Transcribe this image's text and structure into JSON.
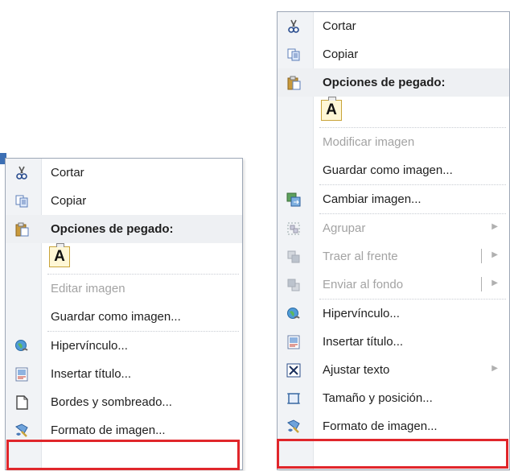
{
  "left_menu": {
    "items": [
      {
        "id": "cut",
        "label": "Cortar",
        "icon": "scissors-icon",
        "type": "item"
      },
      {
        "id": "copy",
        "label": "Copiar",
        "icon": "copy-icon",
        "type": "item"
      },
      {
        "id": "paste-header",
        "label": "Opciones de pegado:",
        "icon": "clipboard-icon",
        "type": "header"
      },
      {
        "id": "paste-text",
        "label": "A",
        "icon": "paste-keep-text-icon",
        "type": "paste"
      },
      {
        "id": "edit-image",
        "label": "Editar imagen",
        "type": "disabled"
      },
      {
        "id": "save-as-image",
        "label": "Guardar como imagen...",
        "type": "item"
      },
      {
        "id": "hyperlink",
        "label": "Hipervínculo...",
        "icon": "globe-link-icon",
        "type": "item"
      },
      {
        "id": "insert-caption",
        "label": "Insertar título...",
        "icon": "caption-icon",
        "type": "item"
      },
      {
        "id": "borders-shading",
        "label": "Bordes y sombreado...",
        "icon": "page-border-icon",
        "type": "item"
      },
      {
        "id": "format-picture",
        "label": "Formato de imagen...",
        "icon": "format-picture-icon",
        "type": "item",
        "highlighted": true
      }
    ]
  },
  "right_menu": {
    "items": [
      {
        "id": "cut",
        "label": "Cortar",
        "icon": "scissors-icon",
        "type": "item"
      },
      {
        "id": "copy",
        "label": "Copiar",
        "icon": "copy-icon",
        "type": "item"
      },
      {
        "id": "paste-header",
        "label": "Opciones de pegado:",
        "icon": "clipboard-icon",
        "type": "header"
      },
      {
        "id": "paste-text",
        "label": "A",
        "icon": "paste-keep-text-icon",
        "type": "paste"
      },
      {
        "id": "modify-image",
        "label": "Modificar imagen",
        "type": "disabled"
      },
      {
        "id": "save-as-image",
        "label": "Guardar como imagen...",
        "type": "item"
      },
      {
        "id": "change-image",
        "label": "Cambiar imagen...",
        "icon": "change-picture-icon",
        "type": "item"
      },
      {
        "id": "group",
        "label": "Agrupar",
        "icon": "group-icon",
        "type": "disabled",
        "submenu": true
      },
      {
        "id": "bring-front",
        "label": "Traer al frente",
        "icon": "bring-front-icon",
        "type": "disabled",
        "submenu": true,
        "split": true
      },
      {
        "id": "send-back",
        "label": "Enviar al fondo",
        "icon": "send-back-icon",
        "type": "disabled",
        "submenu": true,
        "split": true
      },
      {
        "id": "hyperlink",
        "label": "Hipervínculo...",
        "icon": "globe-link-icon",
        "type": "item"
      },
      {
        "id": "insert-caption",
        "label": "Insertar título...",
        "icon": "caption-icon",
        "type": "item"
      },
      {
        "id": "wrap-text",
        "label": "Ajustar texto",
        "icon": "wrap-text-icon",
        "type": "item",
        "submenu": true
      },
      {
        "id": "size-position",
        "label": "Tamaño y posición...",
        "icon": "size-position-icon",
        "type": "item"
      },
      {
        "id": "format-picture",
        "label": "Formato de imagen...",
        "icon": "format-picture-icon",
        "type": "item",
        "highlighted": true
      }
    ]
  },
  "colors": {
    "highlight": "#e0262b",
    "gutter": "#f1f3f6",
    "border": "#9da7b6",
    "disabled_text": "#a3a3a3"
  }
}
